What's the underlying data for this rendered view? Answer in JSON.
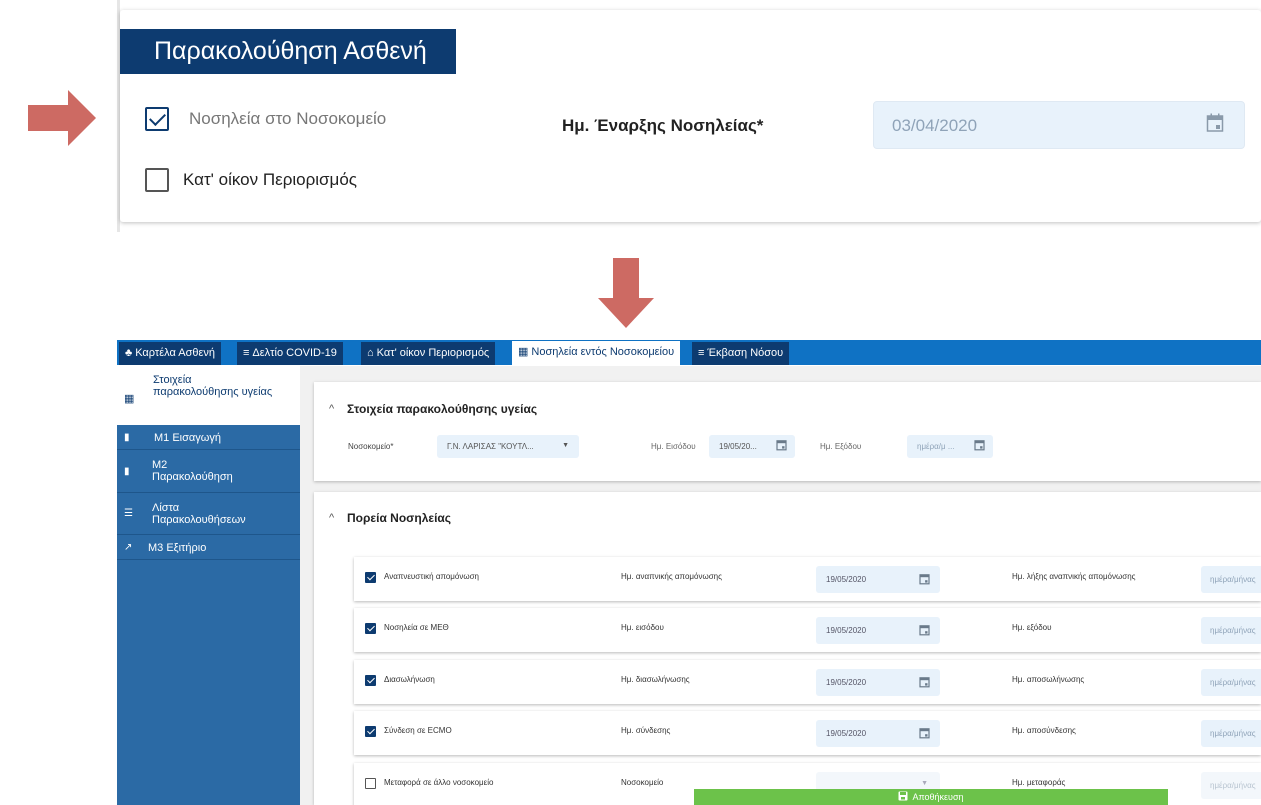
{
  "top_panel": {
    "title": "Παρακολούθηση Ασθενή",
    "hospital_checkbox": {
      "label": "Νοσηλεία στο Νοσοκομείο",
      "checked": true
    },
    "home_checkbox": {
      "label": "Κατ' οίκον Περιορισμός",
      "checked": false
    },
    "start_date_label": "Ημ. Έναρξης Νοσηλείας*",
    "start_date_value": "03/04/2020",
    "accent_color": "#0d3b70",
    "arrow_color": "#cd6a63"
  },
  "tabs": [
    {
      "icon": "users-icon",
      "glyph": "♣",
      "label": "Καρτέλα Ασθενή",
      "active": false
    },
    {
      "icon": "list-icon",
      "glyph": "≡",
      "label": "Δελτίο COVID-19",
      "active": false
    },
    {
      "icon": "home-icon",
      "glyph": "⌂",
      "label": "Κατ' οίκον Περιορισμός",
      "active": false
    },
    {
      "icon": "hospital-icon",
      "glyph": "▦",
      "label": "Νοσηλεία εντός Νοσοκομείου",
      "active": true
    },
    {
      "icon": "list-icon",
      "glyph": "≡",
      "label": "Έκβαση Νόσου",
      "active": false
    }
  ],
  "sidebar": {
    "items": [
      {
        "icon": "hospital-icon",
        "glyph": "▦",
        "label": "Στοιχεία παρακολούθησης υγείας",
        "active": true
      },
      {
        "icon": "file-icon",
        "glyph": "▮",
        "label": "Μ1 Εισαγωγή"
      },
      {
        "icon": "file-icon",
        "glyph": "▮",
        "label": "Μ2 Παρακολούθηση"
      },
      {
        "icon": "list-icon",
        "glyph": "☰",
        "label": "Λίστα Παρακολουθήσεων"
      },
      {
        "icon": "external-link-icon",
        "glyph": "↗",
        "label": "Μ3 Εξιτήριο"
      }
    ]
  },
  "health_section": {
    "title": "Στοιχεία παρακολούθησης υγείας",
    "hospital_label": "Νοσοκομείο*",
    "hospital_value": "Γ.Ν. ΛΑΡΙΣΑΣ \"ΚΟΥΤΛ...",
    "entry_label": "Ημ. Εισόδου",
    "entry_value": "19/05/20...",
    "exit_label": "Ημ. Εξόδου",
    "exit_placeholder": "ημέρα/μ ..."
  },
  "course_section": {
    "title": "Πορεία Νοσηλείας",
    "rows": [
      {
        "label": "Αναπνευστική απομόνωση",
        "checked": true,
        "date_label": "Ημ. αναπνικής απομόνωσης",
        "date_value": "19/05/2020",
        "end_label": "Ημ. λήξης αναπνικής απομόνωσης",
        "end_placeholder": "ημέρα/μήνας"
      },
      {
        "label": "Νοσηλεία σε ΜΕΘ",
        "checked": true,
        "date_label": "Ημ. εισόδου",
        "date_value": "19/05/2020",
        "end_label": "Ημ. εξόδου",
        "end_placeholder": "ημέρα/μήνας"
      },
      {
        "label": "Διασωλήνωση",
        "checked": true,
        "date_label": "Ημ. διασωλήνωσης",
        "date_value": "19/05/2020",
        "end_label": "Ημ. αποσωλήνωσης",
        "end_placeholder": "ημέρα/μήνας"
      },
      {
        "label": "Σύνδεση σε ECMO",
        "checked": true,
        "date_label": "Ημ. σύνδεσης",
        "date_value": "19/05/2020",
        "end_label": "Ημ. αποσύνδεσης",
        "end_placeholder": "ημέρα/μήνας"
      },
      {
        "label": "Μεταφορά σε άλλο νοσοκομείο",
        "checked": false,
        "date_label": "Νοσοκομείο",
        "date_value": "",
        "end_label": "Ημ. μεταφοράς",
        "end_placeholder": "ημέρα/μήνας"
      }
    ]
  },
  "save_button": {
    "label": "Αποθήκευση",
    "icon": "save-icon"
  }
}
